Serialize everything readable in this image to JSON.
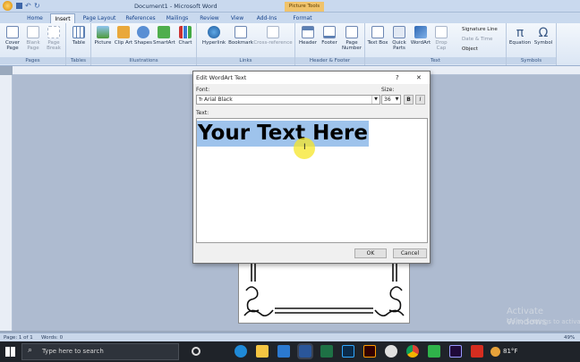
{
  "window": {
    "title": "Document1 - Microsoft Word",
    "context_tab": "Picture Tools"
  },
  "tabs": [
    "Home",
    "Insert",
    "Page Layout",
    "References",
    "Mailings",
    "Review",
    "View",
    "Add-Ins",
    "Format"
  ],
  "active_tab": "Insert",
  "ribbon": {
    "pages_group": {
      "label": "Pages",
      "items": [
        "Cover Page",
        "Blank Page",
        "Page Break"
      ]
    },
    "tables_group": {
      "label": "Tables",
      "items": [
        "Table"
      ]
    },
    "illustrations_group": {
      "label": "Illustrations",
      "items": [
        "Picture",
        "Clip Art",
        "Shapes",
        "SmartArt",
        "Chart"
      ]
    },
    "links_group": {
      "label": "Links",
      "items": [
        "Hyperlink",
        "Bookmark",
        "Cross-reference"
      ]
    },
    "header_footer_group": {
      "label": "Header & Footer",
      "items": [
        "Header",
        "Footer",
        "Page Number"
      ]
    },
    "text_group": {
      "label": "Text",
      "items": [
        "Text Box",
        "Quick Parts",
        "WordArt",
        "Drop Cap"
      ],
      "side_items": [
        "Signature Line",
        "Date & Time",
        "Object"
      ]
    },
    "symbols_group": {
      "label": "Symbols",
      "items": [
        "Equation",
        "Symbol"
      ]
    }
  },
  "dialog": {
    "title": "Edit WordArt Text",
    "help": "?",
    "close": "✕",
    "font_label": "Font:",
    "font_value": "Arial Black",
    "size_label": "Size:",
    "size_value": "36",
    "bold_label": "B",
    "italic_label": "I",
    "text_label": "Text:",
    "text_value": "Your Text Here",
    "ok_label": "OK",
    "cancel_label": "Cancel"
  },
  "status": {
    "page": "Page: 1 of 1",
    "words": "Words: 0",
    "zoom": "49%"
  },
  "watermark": {
    "line1": "Activate Windows",
    "line2": "Go to Settings to activate Windows."
  },
  "taskbar": {
    "search_placeholder": "Type here to search",
    "temperature": "81°F"
  },
  "colors": {
    "selection": "#9ec3ec",
    "ribbon_bg": "#dbe6f4",
    "taskbar": "#1f2329",
    "highlight": "#f5e628"
  }
}
